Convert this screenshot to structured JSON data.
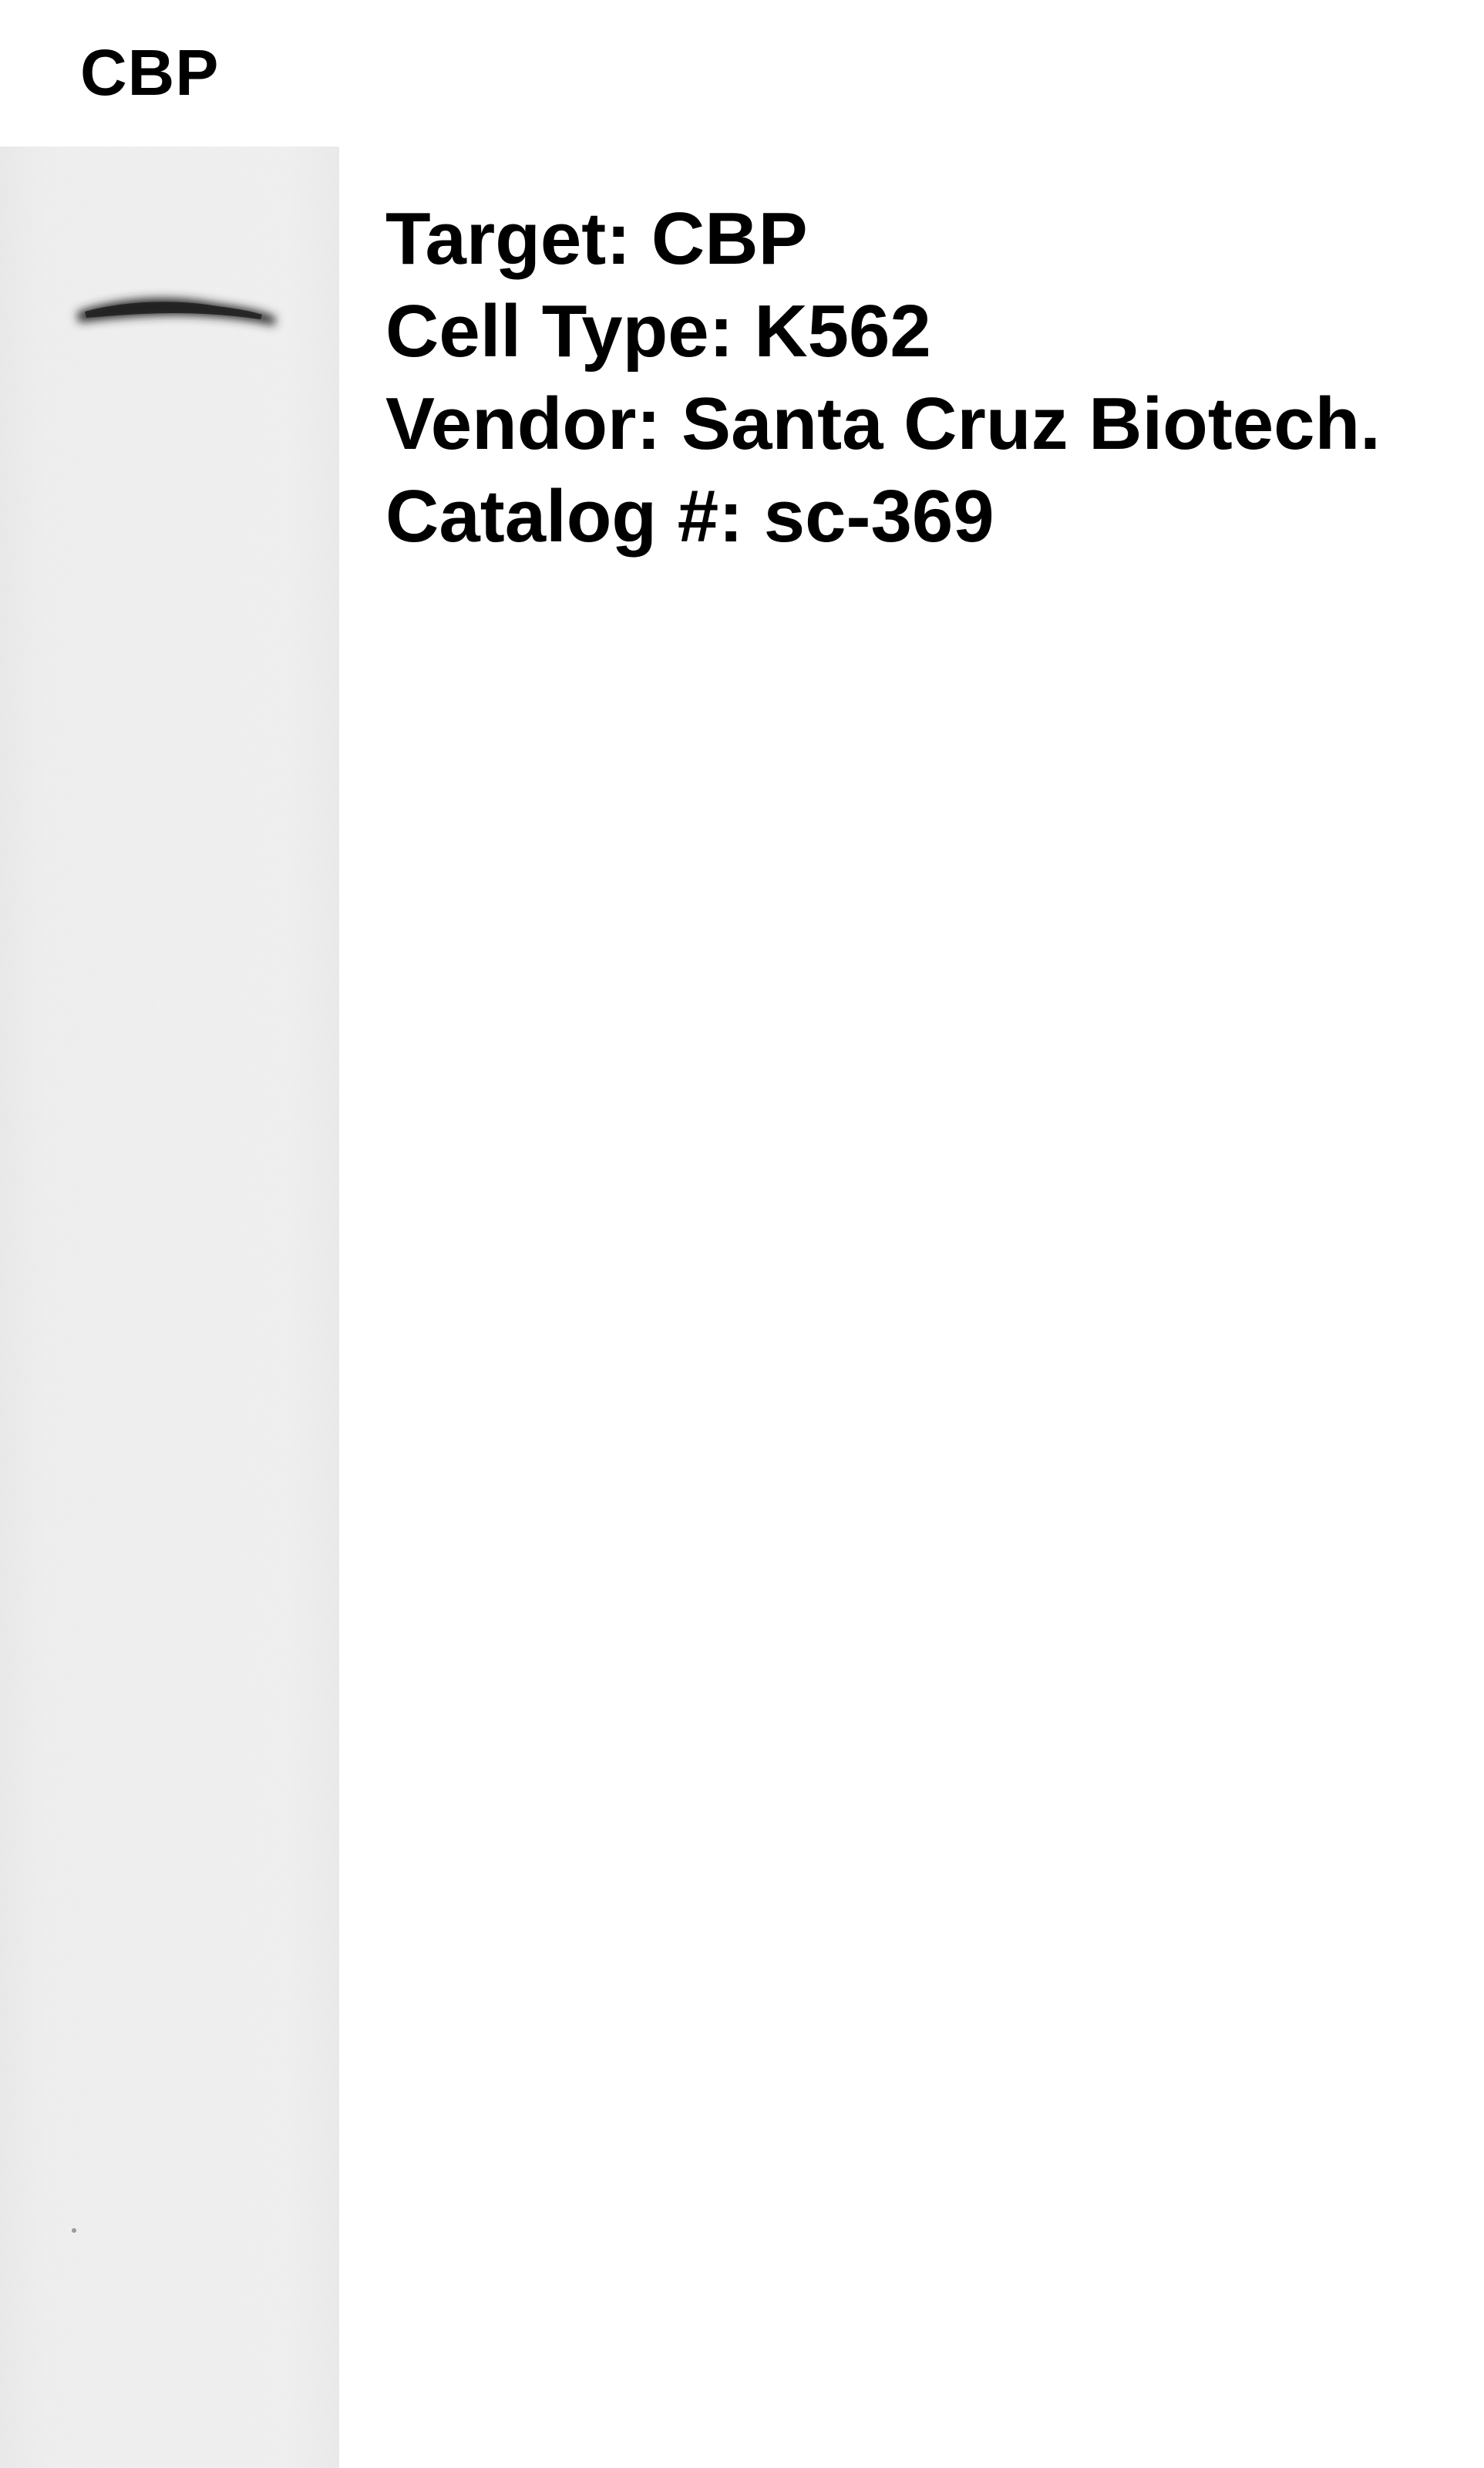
{
  "lane_label": "CBP",
  "info": {
    "target": "Target: CBP",
    "cell_type": "Cell Type: K562",
    "vendor": "Vendor: Santa Cruz Biotech.",
    "catalog": "Catalog #: sc-369"
  },
  "colors": {
    "blot_background": "#f1f1f1",
    "band": "#2a2a2a",
    "text": "#000000"
  }
}
